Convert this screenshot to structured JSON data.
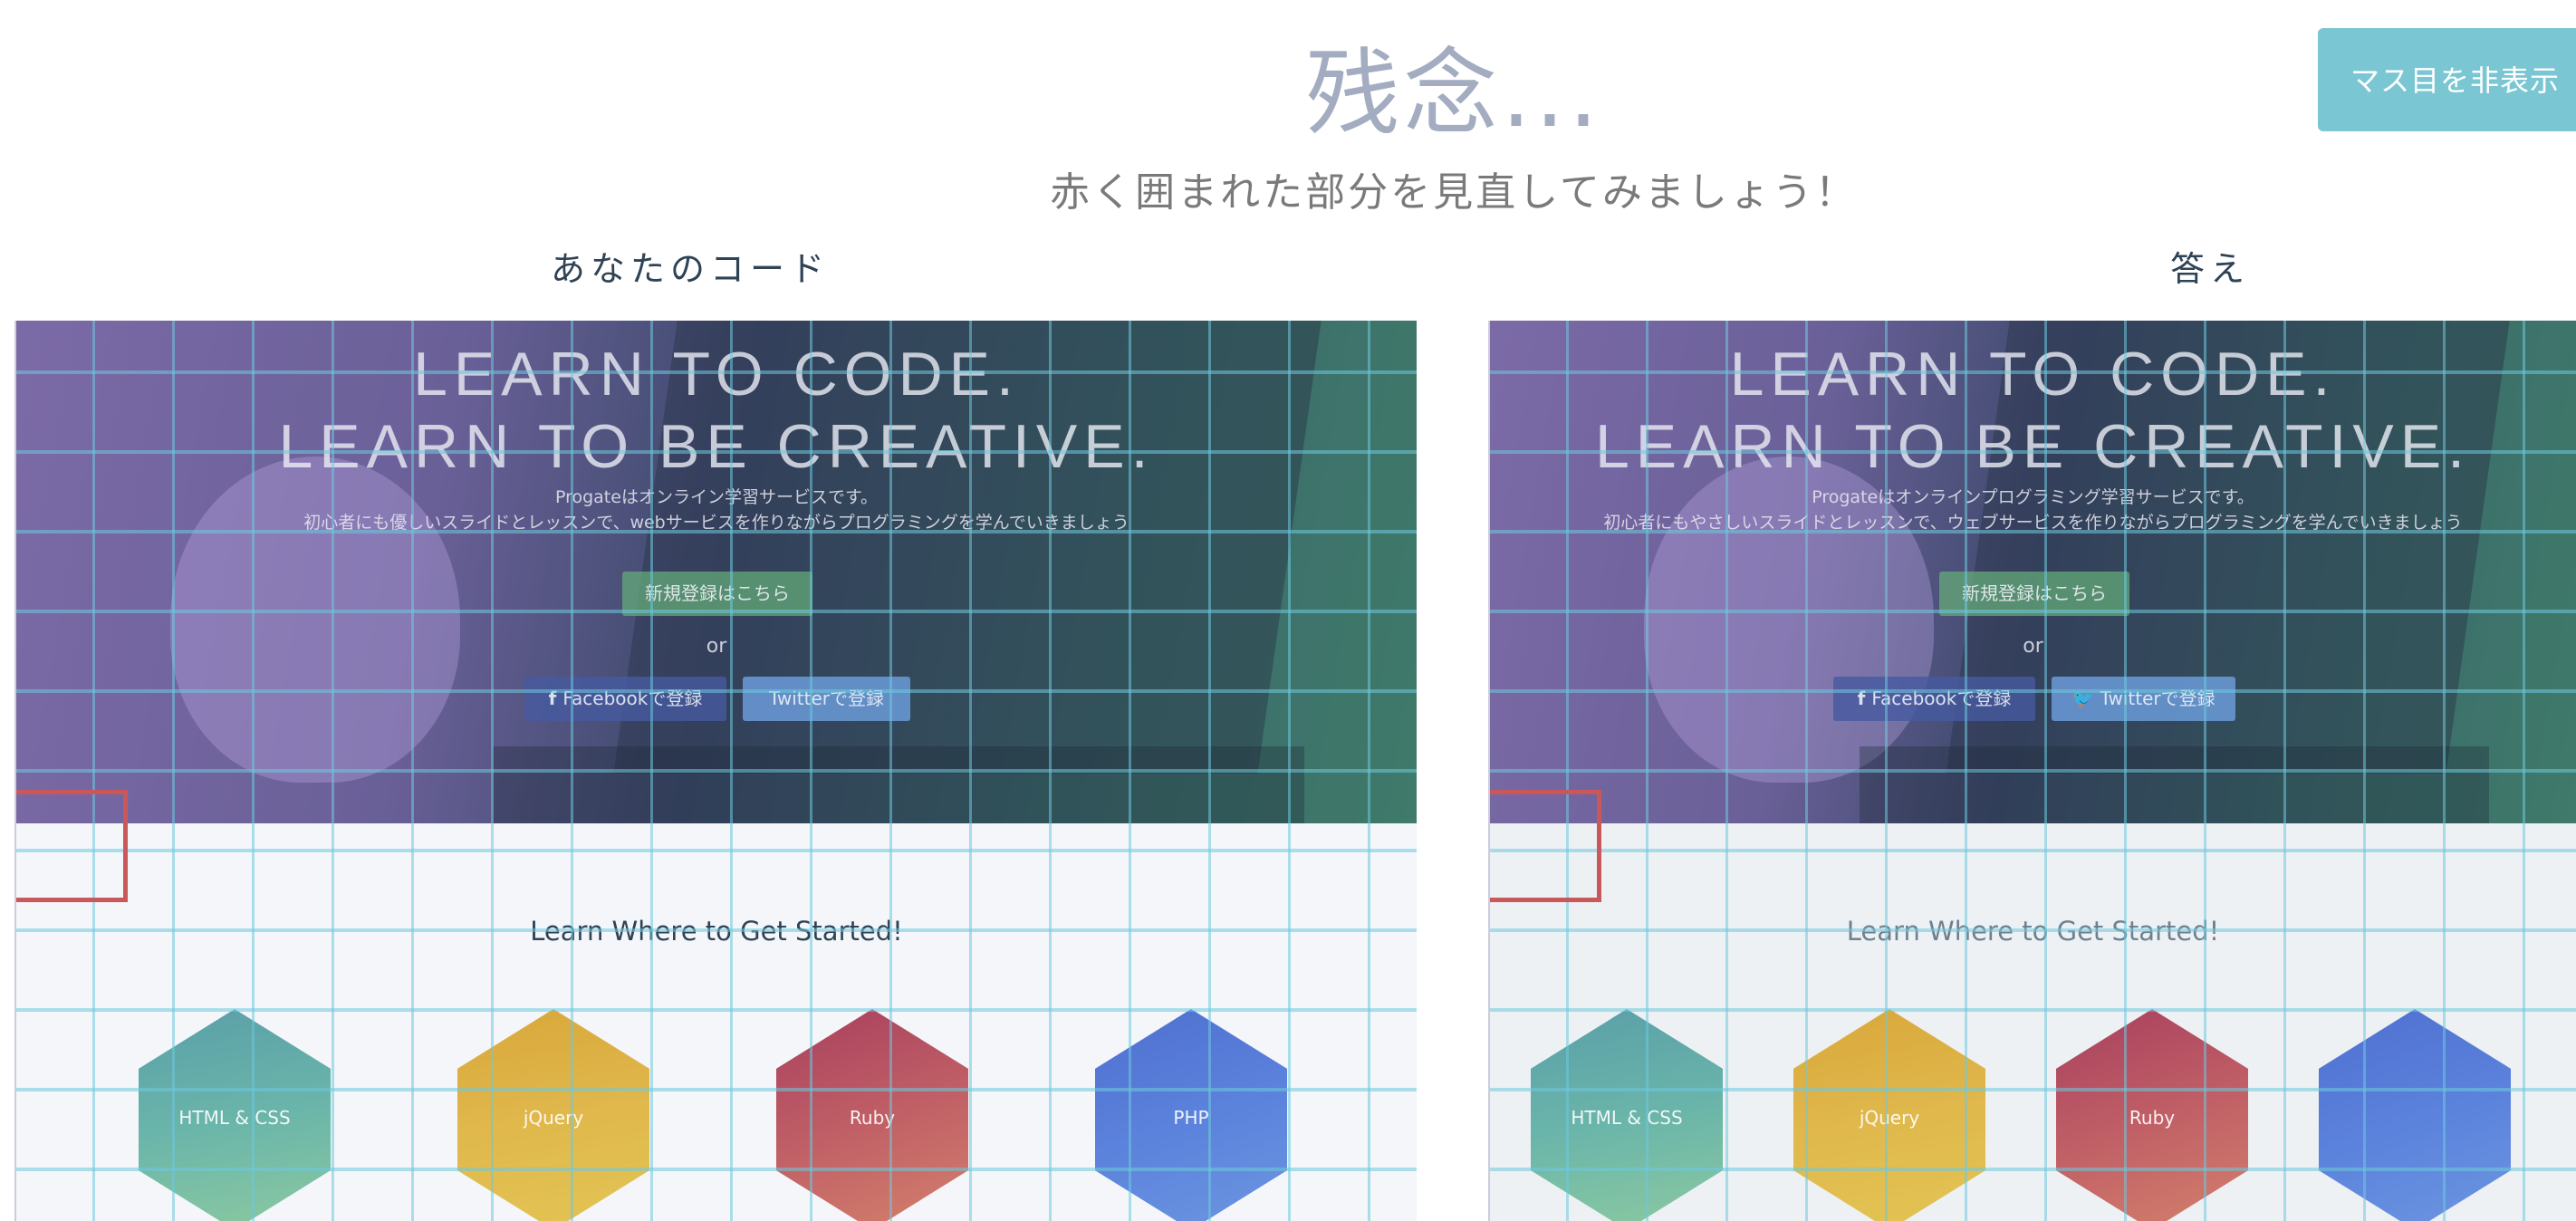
{
  "header": {
    "title": "残念...",
    "subtitle": "赤く囲まれた部分を見直してみましょう！",
    "grid_toggle_label": "マス目を非表示"
  },
  "colors": {
    "accent": "#7ac7d3",
    "error_box": "#c9585b",
    "grid": "#6ec8dc"
  },
  "panels": [
    {
      "label": "あなたのコード",
      "hero": {
        "headline_1": "LEARN TO CODE.",
        "headline_2": "LEARN TO BE CREATIVE.",
        "lead_1": "Progateはオンライン学習サービスです。",
        "lead_2": "初心者にも優しいスライドとレッスンで、webサービスを作りながらプログラミングを学んでいきましょう",
        "signup_label": "新規登録はこちら",
        "or_label": "or",
        "facebook_label": "Facebookで登録",
        "twitter_label": "Twitterで登録",
        "twitter_icon": false
      },
      "section_title": "Learn Where to Get Started!",
      "languages": [
        "HTML & CSS",
        "jQuery",
        "Ruby",
        "PHP"
      ]
    },
    {
      "label": "答え",
      "hero": {
        "headline_1": "LEARN TO CODE.",
        "headline_2": "LEARN TO BE CREATIVE.",
        "lead_1": "Progateはオンラインプログラミング学習サービスです。",
        "lead_2": "初心者にもやさしいスライドとレッスンで、ウェブサービスを作りながらプログラミングを学んでいきましょう",
        "signup_label": "新規登録はこちら",
        "or_label": "or",
        "facebook_label": "Facebookで登録",
        "twitter_label": "Twitterで登録",
        "twitter_icon": true
      },
      "section_title": "Learn Where to Get Started!",
      "languages": [
        "HTML & CSS",
        "jQuery",
        "Ruby",
        ""
      ]
    }
  ]
}
